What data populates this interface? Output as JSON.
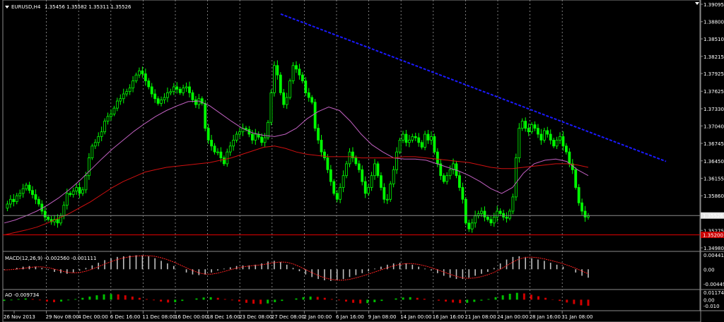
{
  "header": {
    "symbol_timeframe": "EURUSD,H4",
    "ohlc": "1.35456 1.35582 1.35311 1.35526"
  },
  "macd_panel": {
    "label": "MACD(12,26,9) -0.002560 -0.001111"
  },
  "ao_panel": {
    "label": "AO -0.009734"
  },
  "colors": {
    "background": "#000000",
    "grid": "#9a9a9a",
    "candle_up": "#00ff00",
    "candle_down": "#00ff00",
    "ma_fast": "#c060c0",
    "ma_slow": "#d01010",
    "trendline": "#1a1aff",
    "hline": "#cc0000",
    "bid_line": "#8a8a8a",
    "macd_hist": "#c0c0c0",
    "macd_signal": "#ff2020",
    "ao_up": "#00c000",
    "ao_down": "#d00000"
  },
  "chart_data": [
    {
      "type": "candlestick",
      "title": "EURUSD,H4 1.35456 1.35582 1.35311 1.35526",
      "y_ticks": [
        "1.39095",
        "1.38800",
        "1.38510",
        "1.38215",
        "1.37925",
        "1.37625",
        "1.37330",
        "1.37040",
        "1.36745",
        "1.36450",
        "1.36155",
        "1.35860",
        "1.35526",
        "1.35275",
        "1.35200",
        "1.34980"
      ],
      "ylim": [
        1.3498,
        1.39095
      ],
      "x_ticks": [
        "26 Nov 2013",
        "29 Nov 08:00",
        "4 Dec 00:00",
        "6 Dec 16:00",
        "11 Dec 08:00",
        "16 Dec 00:00",
        "18 Dec 16:00",
        "23 Dec 08:00",
        "27 Dec 08:00",
        "2 Jan 00:00",
        "6 Jan 16:00",
        "9 Jan 08:00",
        "14 Jan 00:00",
        "16 Jan 16:00",
        "21 Jan 08:00",
        "24 Jan 00:00",
        "28 Jan 16:00",
        "31 Jan 08:00"
      ],
      "current_price": "1.35526",
      "horizontal_line": "1.35200",
      "close_path": [
        1.3565,
        1.3572,
        1.358,
        1.3576,
        1.3586,
        1.359,
        1.3598,
        1.3604,
        1.3595,
        1.3588,
        1.358,
        1.3572,
        1.356,
        1.355,
        1.3546,
        1.3542,
        1.3546,
        1.354,
        1.3552,
        1.357,
        1.359,
        1.3588,
        1.3594,
        1.36,
        1.359,
        1.3596,
        1.362,
        1.365,
        1.367,
        1.3676,
        1.3686,
        1.3694,
        1.3712,
        1.372,
        1.3724,
        1.3734,
        1.3746,
        1.375,
        1.3758,
        1.3762,
        1.3768,
        1.378,
        1.379,
        1.3797,
        1.3792,
        1.378,
        1.377,
        1.3758,
        1.375,
        1.3742,
        1.3748,
        1.3752,
        1.376,
        1.3762,
        1.377,
        1.3766,
        1.376,
        1.3768,
        1.377,
        1.376,
        1.3748,
        1.374,
        1.375,
        1.3742,
        1.37,
        1.368,
        1.367,
        1.366,
        1.366,
        1.365,
        1.364,
        1.366,
        1.367,
        1.368,
        1.369,
        1.3694,
        1.37,
        1.3698,
        1.369,
        1.368,
        1.369,
        1.3685,
        1.3676,
        1.3684,
        1.371,
        1.376,
        1.3806,
        1.379,
        1.376,
        1.374,
        1.3752,
        1.378,
        1.3806,
        1.38,
        1.379,
        1.378,
        1.376,
        1.3752,
        1.3744,
        1.37,
        1.368,
        1.366,
        1.365,
        1.363,
        1.361,
        1.359,
        1.358,
        1.36,
        1.362,
        1.364,
        1.366,
        1.365,
        1.364,
        1.363,
        1.361,
        1.359,
        1.36,
        1.362,
        1.364,
        1.362,
        1.36,
        1.358,
        1.358,
        1.3606,
        1.363,
        1.366,
        1.368,
        1.369,
        1.3676,
        1.368,
        1.3686,
        1.3684,
        1.3676,
        1.3668,
        1.369,
        1.368,
        1.3686,
        1.366,
        1.364,
        1.362,
        1.361,
        1.362,
        1.363,
        1.364,
        1.362,
        1.36,
        1.358,
        1.354,
        1.353,
        1.354,
        1.3552,
        1.3556,
        1.356,
        1.355,
        1.3546,
        1.354,
        1.355,
        1.356,
        1.3556,
        1.355,
        1.3548,
        1.356,
        1.3584,
        1.365,
        1.37,
        1.3712,
        1.37,
        1.3694,
        1.3706,
        1.37,
        1.369,
        1.368,
        1.3696,
        1.369,
        1.368,
        1.367,
        1.368,
        1.3686,
        1.367,
        1.366,
        1.364,
        1.363,
        1.36,
        1.3574,
        1.356,
        1.355,
        1.3552
      ],
      "series": [
        {
          "name": "MA fast",
          "values": [
            1.354,
            1.3545,
            1.3552,
            1.356,
            1.357,
            1.3582,
            1.3596,
            1.3612,
            1.363,
            1.3648,
            1.3665,
            1.368,
            1.3695,
            1.3708,
            1.372,
            1.373,
            1.3738,
            1.3745,
            1.3746,
            1.3738,
            1.3725,
            1.3712,
            1.37,
            1.3692,
            1.3688,
            1.3686,
            1.369,
            1.37,
            1.3716,
            1.3728,
            1.3736,
            1.373,
            1.3712,
            1.369,
            1.3672,
            1.366,
            1.365,
            1.3648,
            1.3648,
            1.3646,
            1.364,
            1.3634,
            1.3628,
            1.362,
            1.361,
            1.3598,
            1.359,
            1.36,
            1.3624,
            1.364,
            1.3646,
            1.3648,
            1.3644,
            1.363,
            1.362
          ]
        },
        {
          "name": "MA slow",
          "values": [
            1.352,
            1.3524,
            1.3528,
            1.3533,
            1.354,
            1.3548,
            1.3556,
            1.3566,
            1.3576,
            1.3588,
            1.36,
            1.361,
            1.3618,
            1.3626,
            1.363,
            1.3634,
            1.3636,
            1.3638,
            1.364,
            1.3642,
            1.3646,
            1.365,
            1.3656,
            1.3662,
            1.3668,
            1.367,
            1.3666,
            1.366,
            1.3656,
            1.3654,
            1.3652,
            1.3652,
            1.3652,
            1.365,
            1.365,
            1.365,
            1.365,
            1.3652,
            1.3652,
            1.365,
            1.3648,
            1.3646,
            1.3644,
            1.3642,
            1.3638,
            1.3634,
            1.3632,
            1.3632,
            1.3634,
            1.3636,
            1.3638,
            1.364,
            1.364,
            1.3638,
            1.3634
          ]
        }
      ],
      "trendline": {
        "from_price": 1.3893,
        "to_price": 1.3644
      }
    },
    {
      "type": "bar",
      "title": "MACD(12,26,9) -0.002560 -0.001111",
      "y_ticks": [
        "0.004413",
        "0.00",
        "-0.004496"
      ],
      "ylim": [
        -0.004496,
        0.004413
      ],
      "values": [
        -0.0002,
        0.0,
        0.0004,
        0.0008,
        0.001,
        0.0008,
        0.0004,
        -0.0002,
        -0.0008,
        -0.0012,
        -0.0014,
        -0.001,
        -0.0004,
        0.0004,
        0.0012,
        0.002,
        0.0028,
        0.0034,
        0.0038,
        0.004,
        0.0042,
        0.0043,
        0.0042,
        0.004,
        0.0034,
        0.0026,
        0.0018,
        0.001,
        0.0,
        -0.001,
        -0.0016,
        -0.0018,
        -0.0016,
        -0.001,
        -0.0004,
        0.0002,
        0.0006,
        0.001,
        0.0012,
        0.0012,
        0.0014,
        0.0018,
        0.0024,
        0.0026,
        0.0022,
        0.0014,
        0.0004,
        -0.0006,
        -0.0016,
        -0.0024,
        -0.003,
        -0.0034,
        -0.0036,
        -0.0034,
        -0.003,
        -0.0024,
        -0.0018,
        -0.0012,
        -0.0006,
        0.0002,
        0.0008,
        0.0014,
        0.0018,
        0.002,
        0.0018,
        0.0014,
        0.0008,
        0.0002,
        -0.0004,
        -0.0012,
        -0.002,
        -0.0026,
        -0.003,
        -0.003,
        -0.0026,
        -0.002,
        -0.0014,
        -0.0008,
        0.0004,
        0.0018,
        0.003,
        0.0038,
        0.004,
        0.0038,
        0.0034,
        0.003,
        0.0026,
        0.002,
        0.0014,
        0.0008,
        0.0,
        -0.001,
        -0.002,
        -0.0026
      ]
    },
    {
      "type": "bar",
      "title": "AO -0.009734",
      "y_ticks": [
        "0.011742",
        "0.00",
        "-0.010"
      ],
      "ylim": [
        -0.012,
        0.011742
      ],
      "values": [
        -0.002,
        -0.001,
        0.001,
        0.002,
        0.001,
        -0.001,
        -0.003,
        -0.004,
        -0.003,
        -0.001,
        0.001,
        0.003,
        0.005,
        0.007,
        0.0085,
        0.009,
        0.0085,
        0.007,
        0.005,
        0.003,
        0.001,
        -0.001,
        -0.003,
        -0.0045,
        -0.004,
        -0.002,
        0.0,
        0.002,
        0.0035,
        0.004,
        0.003,
        0.001,
        -0.001,
        -0.003,
        -0.005,
        -0.0065,
        -0.007,
        -0.006,
        -0.004,
        -0.002,
        0.0,
        0.002,
        0.004,
        0.005,
        0.0045,
        0.003,
        0.001,
        -0.001,
        -0.003,
        -0.005,
        -0.006,
        -0.0055,
        -0.004,
        -0.002,
        0.0,
        0.002,
        0.0035,
        0.004,
        0.003,
        0.0015,
        0.0,
        -0.0015,
        -0.003,
        -0.0045,
        -0.0055,
        -0.005,
        -0.0035,
        -0.0015,
        0.001,
        0.004,
        0.007,
        0.0095,
        0.011,
        0.01,
        0.008,
        0.0055,
        0.003,
        0.0005,
        -0.002,
        -0.0045,
        -0.007,
        -0.009,
        -0.0097
      ]
    }
  ]
}
